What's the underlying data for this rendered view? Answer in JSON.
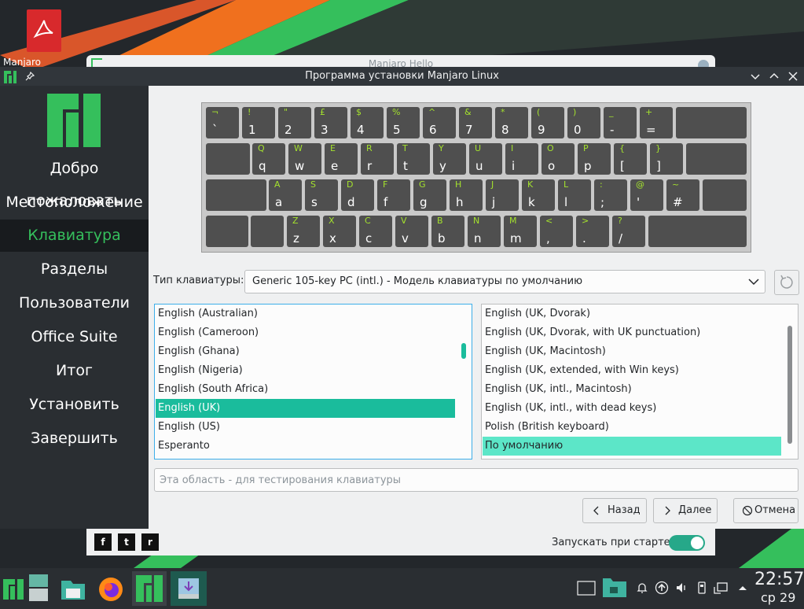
{
  "window": {
    "title": "Программа установки Manjaro Linux"
  },
  "background_window": {
    "title": "Manjaro Hello",
    "autostart_label": "Запускать при старте",
    "autostart_on": true,
    "social_icons": [
      "facebook-icon",
      "twitter-icon",
      "reddit-icon"
    ]
  },
  "desktop": {
    "icon_label": "Manjaro"
  },
  "sidebar": {
    "items": [
      {
        "label": "Добро пожаловать"
      },
      {
        "label": "Местоположение"
      },
      {
        "label": "Клавиатура",
        "active": true
      },
      {
        "label": "Разделы"
      },
      {
        "label": "Пользователи"
      },
      {
        "label": "Office Suite"
      },
      {
        "label": "Итог"
      },
      {
        "label": "Установить"
      },
      {
        "label": "Завершить"
      }
    ]
  },
  "keyboard": {
    "rows": [
      [
        {
          "u": "¬",
          "l": "`"
        },
        {
          "u": "!",
          "l": "1"
        },
        {
          "u": "\"",
          "l": "2"
        },
        {
          "u": "£",
          "l": "3"
        },
        {
          "u": "$",
          "l": "4"
        },
        {
          "u": "%",
          "l": "5"
        },
        {
          "u": "^",
          "l": "6"
        },
        {
          "u": "&",
          "l": "7"
        },
        {
          "u": "*",
          "l": "8"
        },
        {
          "u": "(",
          "l": "9"
        },
        {
          "u": ")",
          "l": "0"
        },
        {
          "u": "_",
          "l": "-"
        },
        {
          "u": "+",
          "l": "="
        },
        {
          "u": "",
          "l": ""
        }
      ],
      [
        {
          "u": "",
          "l": ""
        },
        {
          "u": "Q",
          "l": "q"
        },
        {
          "u": "W",
          "l": "w"
        },
        {
          "u": "E",
          "l": "e"
        },
        {
          "u": "R",
          "l": "r"
        },
        {
          "u": "T",
          "l": "t"
        },
        {
          "u": "Y",
          "l": "y"
        },
        {
          "u": "U",
          "l": "u"
        },
        {
          "u": "I",
          "l": "i"
        },
        {
          "u": "O",
          "l": "o"
        },
        {
          "u": "P",
          "l": "p"
        },
        {
          "u": "{",
          "l": "["
        },
        {
          "u": "}",
          "l": "]"
        },
        {
          "u": "",
          "l": ""
        }
      ],
      [
        {
          "u": "",
          "l": ""
        },
        {
          "u": "A",
          "l": "a"
        },
        {
          "u": "S",
          "l": "s"
        },
        {
          "u": "D",
          "l": "d"
        },
        {
          "u": "F",
          "l": "f"
        },
        {
          "u": "G",
          "l": "g"
        },
        {
          "u": "H",
          "l": "h"
        },
        {
          "u": "J",
          "l": "j"
        },
        {
          "u": "K",
          "l": "k"
        },
        {
          "u": "L",
          "l": "l"
        },
        {
          "u": ":",
          "l": ";"
        },
        {
          "u": "@",
          "l": "'"
        },
        {
          "u": "~",
          "l": "#"
        },
        {
          "u": "",
          "l": ""
        }
      ],
      [
        {
          "u": "",
          "l": ""
        },
        {
          "u": "",
          "l": ""
        },
        {
          "u": "Z",
          "l": "z"
        },
        {
          "u": "X",
          "l": "x"
        },
        {
          "u": "C",
          "l": "c"
        },
        {
          "u": "V",
          "l": "v"
        },
        {
          "u": "B",
          "l": "b"
        },
        {
          "u": "N",
          "l": "n"
        },
        {
          "u": "M",
          "l": "m"
        },
        {
          "u": "<",
          "l": ","
        },
        {
          "u": ">",
          "l": "."
        },
        {
          "u": "?",
          "l": "/"
        },
        {
          "u": "",
          "l": ""
        }
      ]
    ]
  },
  "keyboard_type": {
    "label": "Тип клавиатуры:",
    "value": "Generic 105-key PC (intl.)  -  Модель клавиатуры по умолчанию"
  },
  "layouts": [
    "English (Australian)",
    "English (Cameroon)",
    "English (Ghana)",
    "English (Nigeria)",
    "English (South Africa)",
    "English (UK)",
    "English (US)",
    "Esperanto"
  ],
  "layouts_selected": "English (UK)",
  "variants": [
    "English (UK, Dvorak)",
    "English (UK, Dvorak, with UK punctuation)",
    "English (UK, Macintosh)",
    "English (UK, extended, with Win keys)",
    "English (UK, intl., Macintosh)",
    "English (UK, intl., with dead keys)",
    "Polish (British keyboard)",
    "По умолчанию"
  ],
  "variants_selected": "По умолчанию",
  "test_area": {
    "placeholder": "Эта область - для тестирования клавиатуры"
  },
  "buttons": {
    "back": "Назад",
    "next": "Далее",
    "cancel": "Отмена"
  },
  "taskbar": {
    "time": "22:57",
    "date": "ср 29"
  },
  "colors": {
    "accent": "#35bf5c",
    "selection": "#1abc9c",
    "selection_alt": "#5ce6c8",
    "key_upper": "#a4e22d",
    "sidebar": "#2a2e32"
  }
}
